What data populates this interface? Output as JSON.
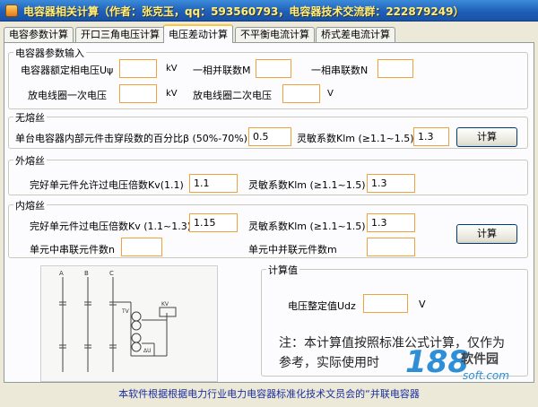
{
  "window": {
    "title": "电容器相关计算（作者：张克玉，qq：593560793，电容器技术交流群：222879249）"
  },
  "tabs": [
    "电容参数计算",
    "开口三角电压计算",
    "电压差动计算",
    "不平衡电流计算",
    "桥式差电流计算"
  ],
  "params": {
    "group_label": "电容器参数输入",
    "rated_voltage_label": "电容器额定相电压Uψ",
    "rated_voltage_unit": "kV",
    "rated_voltage_value": "",
    "parallel_label": "一相并联数M",
    "parallel_value": "",
    "series_label": "一相串联数N",
    "series_value": "",
    "coil_primary_label": "放电线圈一次电压",
    "coil_primary_unit": "kV",
    "coil_primary_value": "",
    "coil_secondary_label": "放电线圈二次电压",
    "coil_secondary_unit": "V",
    "coil_secondary_value": ""
  },
  "no_fuse": {
    "group_label": "无熔丝",
    "percent_label": "单台电容器内部元件击穿段数的百分比β (50%-70%)",
    "percent_value": "0.5",
    "sens_label": "灵敏系数Klm (≥1.1~1.5)",
    "sens_value": "1.3",
    "calc_label": "计算"
  },
  "external_fuse": {
    "group_label": "外熔丝",
    "kv_label": "完好单元件允许过电压倍数Kv(1.1)",
    "kv_value": "1.1",
    "sens_label": "灵敏系数Klm (≥1.1~1.5)",
    "sens_value": "1.3"
  },
  "internal_fuse": {
    "group_label": "内熔丝",
    "kv_label": "完好单元件过电压倍数Kv (1.1~1.3)",
    "kv_value": "1.15",
    "sens_label": "灵敏系数Klm (≥1.1~1.5)",
    "sens_value": "1.3",
    "series_label": "单元中串联元件数n",
    "series_value": "",
    "parallel_label": "单元中并联元件数m",
    "parallel_value": "",
    "calc_label": "计算"
  },
  "diagram": {
    "labels": [
      "A",
      "B",
      "C",
      "TV",
      "KV",
      "ΔU"
    ]
  },
  "result": {
    "group_label": "计算值",
    "voltage_label": "电压整定值Udz",
    "voltage_value": "",
    "voltage_unit": "V",
    "note_line1": "注：本计算值按照标准公式计算，仅作为",
    "note_line2": "参考，实际使用时"
  },
  "footer": {
    "text": "本软件根据根据电力行业电力电容器标准化技术文员会的“并联电容器"
  },
  "watermark": {
    "number": "188",
    "cn": "软件园",
    "en": "soft.com"
  },
  "colors": {
    "title_bg": "#1f5fb8",
    "input_border": "#f0a23c",
    "footer_text": "#1a2e9c",
    "watermark": "#2e8fd6"
  }
}
